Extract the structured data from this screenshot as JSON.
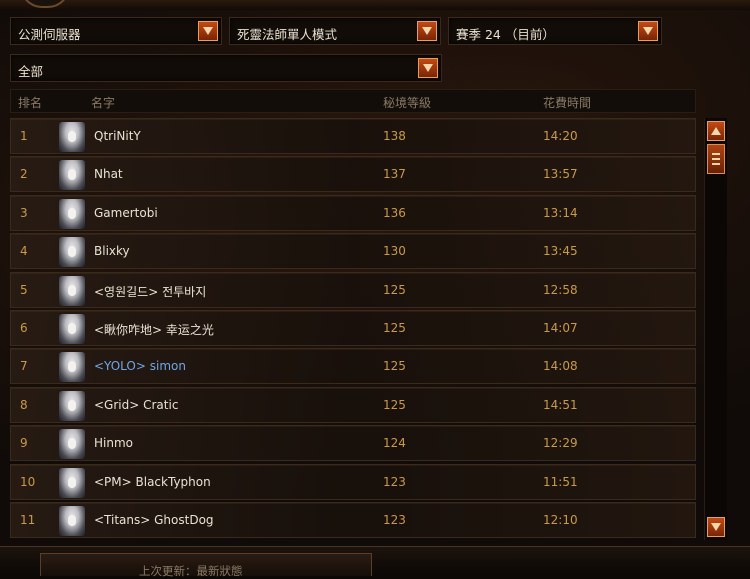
{
  "filters": {
    "server": "公測伺服器",
    "class_mode": "死靈法師單人模式",
    "season": "賽季 24 （目前）",
    "category": "全部"
  },
  "columns": {
    "rank": "排名",
    "name": "名字",
    "level": "秘境等級",
    "time": "花費時間"
  },
  "rows": [
    {
      "rank": "1",
      "name": "QtriNitY",
      "level": "138",
      "time": "14:20",
      "highlight": false
    },
    {
      "rank": "2",
      "name": "Nhat",
      "level": "137",
      "time": "13:57",
      "highlight": false
    },
    {
      "rank": "3",
      "name": "Gamertobi",
      "level": "136",
      "time": "13:14",
      "highlight": false
    },
    {
      "rank": "4",
      "name": "Blixky",
      "level": "130",
      "time": "13:45",
      "highlight": false
    },
    {
      "rank": "5",
      "name": "<영원길드> 전투바지",
      "level": "125",
      "time": "12:58",
      "highlight": false
    },
    {
      "rank": "6",
      "name": "<瞅你咋地> 幸运之光",
      "level": "125",
      "time": "14:07",
      "highlight": false
    },
    {
      "rank": "7",
      "name": "<YOLO> simon",
      "level": "125",
      "time": "14:08",
      "highlight": true
    },
    {
      "rank": "8",
      "name": "<Grid> Cratic",
      "level": "125",
      "time": "14:51",
      "highlight": false
    },
    {
      "rank": "9",
      "name": "Hinmo",
      "level": "124",
      "time": "12:29",
      "highlight": false
    },
    {
      "rank": "10",
      "name": "<PM> BlackTyphon",
      "level": "123",
      "time": "11:51",
      "highlight": false
    },
    {
      "rank": "11",
      "name": "<Titans> GhostDog",
      "level": "123",
      "time": "12:10",
      "highlight": false
    }
  ],
  "footer": {
    "last_updated": "上次更新：最新狀態"
  },
  "icons": {
    "dropdown": "chevron-down-icon",
    "scroll_up": "arrow-up-icon",
    "scroll_down": "arrow-down-icon",
    "portrait": "necromancer-portrait-icon"
  },
  "colors": {
    "accent": "#c24a14",
    "value_text": "#c89a4a",
    "highlight_name": "#6ea6e6"
  }
}
